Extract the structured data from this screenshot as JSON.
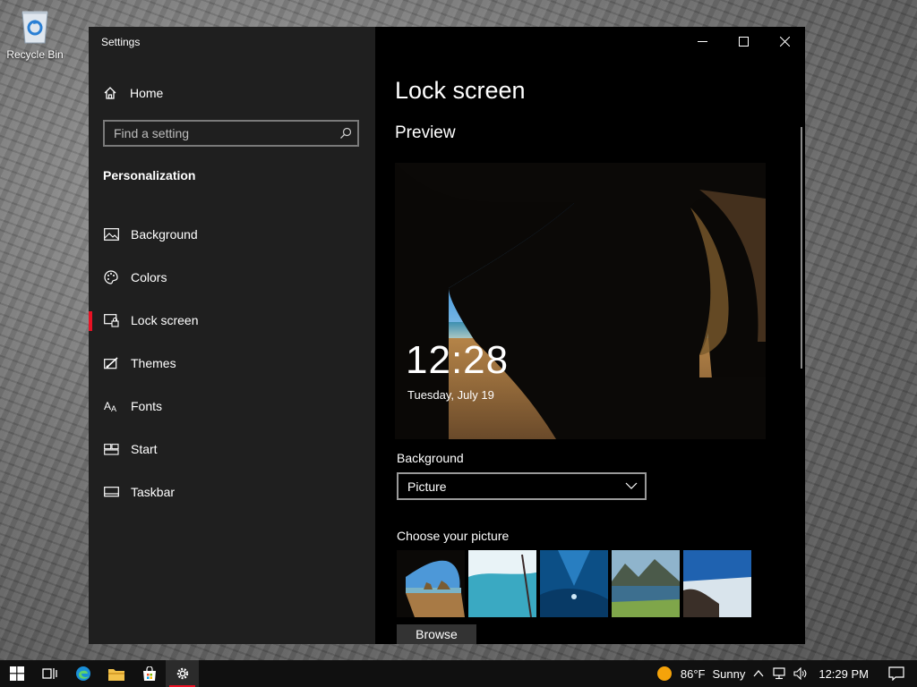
{
  "desktop": {
    "recycle_bin_label": "Recycle Bin"
  },
  "window": {
    "title": "Settings",
    "controls": {
      "minimize_icon": "minimize-icon",
      "maximize_icon": "maximize-icon",
      "close_icon": "close-icon"
    }
  },
  "sidebar": {
    "home_label": "Home",
    "search_placeholder": "Find a setting",
    "section_title": "Personalization",
    "items": [
      {
        "label": "Background",
        "icon": "picture-icon",
        "active": false
      },
      {
        "label": "Colors",
        "icon": "palette-icon",
        "active": false
      },
      {
        "label": "Lock screen",
        "icon": "lock-screen-icon",
        "active": true
      },
      {
        "label": "Themes",
        "icon": "themes-icon",
        "active": false
      },
      {
        "label": "Fonts",
        "icon": "fonts-icon",
        "active": false
      },
      {
        "label": "Start",
        "icon": "start-icon",
        "active": false
      },
      {
        "label": "Taskbar",
        "icon": "taskbar-icon",
        "active": false
      }
    ]
  },
  "main": {
    "page_title": "Lock screen",
    "preview_title": "Preview",
    "preview_time": "12:28",
    "preview_date": "Tuesday, July 19",
    "background_label": "Background",
    "background_selected": "Picture",
    "choose_picture_label": "Choose your picture",
    "browse_label": "Browse"
  },
  "taskbar": {
    "weather_temp": "86°F",
    "weather_condition": "Sunny",
    "time": "12:29 PM",
    "accent_color": "#e81123"
  }
}
